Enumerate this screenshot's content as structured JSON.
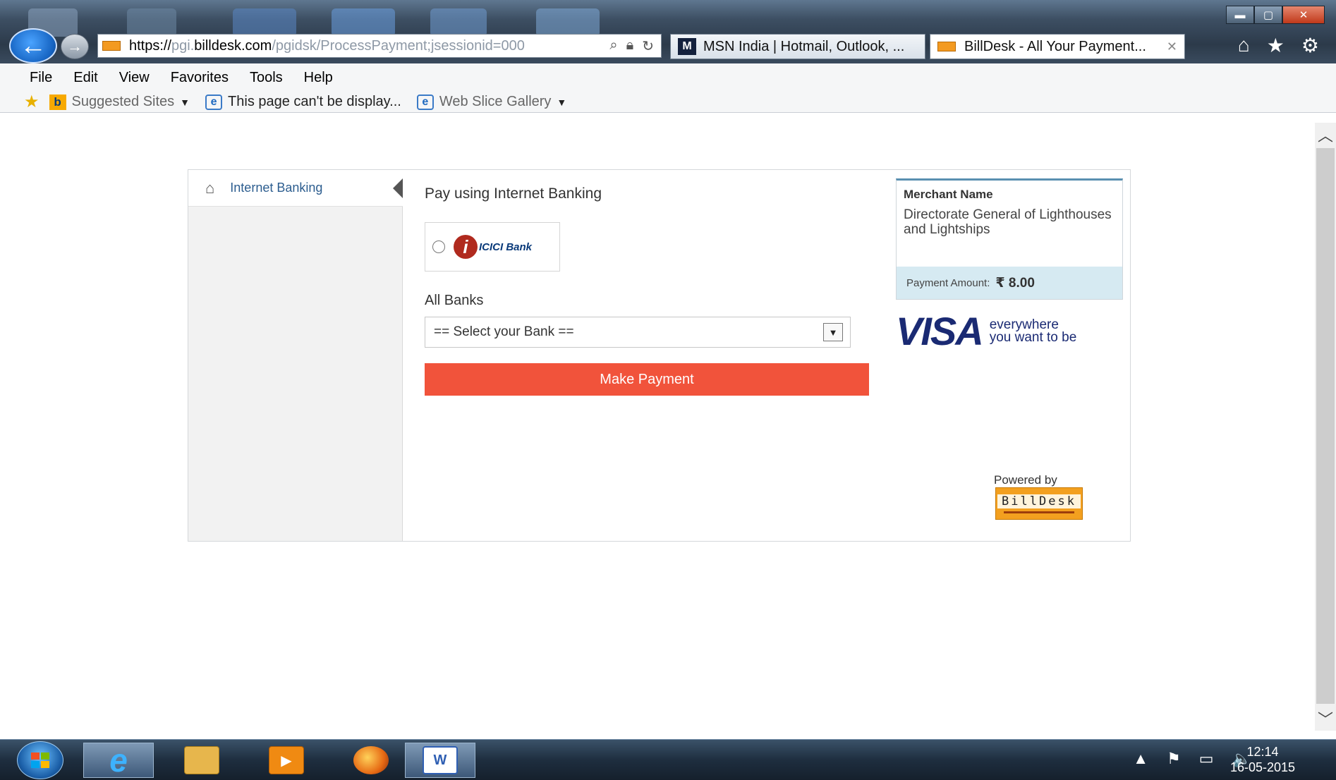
{
  "window": {
    "controls": {
      "minimize": "▬",
      "maximize": "▢",
      "close": "✕"
    }
  },
  "browser": {
    "back_icon": "←",
    "forward_icon": "→",
    "address": {
      "prefix": "https://",
      "host_dim": "pgi.",
      "host": "billdesk.com",
      "path": "/pgidsk/ProcessPayment;jsessionid=000"
    },
    "address_icons": [
      "search-icon",
      "lock-icon",
      "refresh-icon"
    ],
    "tabs": [
      {
        "label": "MSN India | Hotmail, Outlook, ...",
        "icon_text": "M"
      },
      {
        "label": "BillDesk - All Your Payment...",
        "active": true
      }
    ],
    "chrome_icons": {
      "home": "⌂",
      "favorites": "★",
      "tools": "⚙"
    }
  },
  "menubar": {
    "items": [
      "File",
      "Edit",
      "View",
      "Favorites",
      "Tools",
      "Help"
    ]
  },
  "favorites_bar": {
    "items": [
      {
        "label": "Suggested Sites",
        "icon": "bing-icon",
        "dropdown": true
      },
      {
        "label": "This page can't be display...",
        "icon": "ie-page-icon",
        "dropdown": false
      },
      {
        "label": "Web Slice Gallery",
        "icon": "ie-page-icon",
        "dropdown": true
      }
    ]
  },
  "payment": {
    "nav": {
      "label": "Internet Banking",
      "icon": "home-icon"
    },
    "heading": "Pay using Internet Banking",
    "icici": {
      "logo_letter": "i",
      "logo_text": "ICICI Bank"
    },
    "all_banks_label": "All Banks",
    "bank_select": {
      "selected": "== Select your Bank =="
    },
    "make_payment_label": "Make Payment",
    "merchant": {
      "title": "Merchant Name",
      "name": "Directorate General of Lighthouses and Lightships",
      "amount_label": "Payment Amount:",
      "amount_value": "₹ 8.00"
    },
    "visa": {
      "word": "VISA",
      "tag_line1": "everywhere",
      "tag_line2": "you want to be"
    },
    "powered_by": "Powered by",
    "billdesk_logo": "BillDesk"
  },
  "taskbar": {
    "apps": [
      "ie-icon",
      "file-explorer-icon",
      "media-player-icon",
      "firefox-icon",
      "word-icon"
    ],
    "tray": {
      "expand": "▲",
      "flag": "⚑",
      "network": "▭",
      "volume": "🔈"
    },
    "clock": {
      "time": "12:14",
      "date": "16-05-2015"
    }
  },
  "colors": {
    "accent_button": "#f1533b",
    "amount_strip": "#d6eaf2",
    "nav_link": "#2c5d8f",
    "visa_blue": "#1a2a73",
    "billdesk_orange": "#f3a01f"
  }
}
